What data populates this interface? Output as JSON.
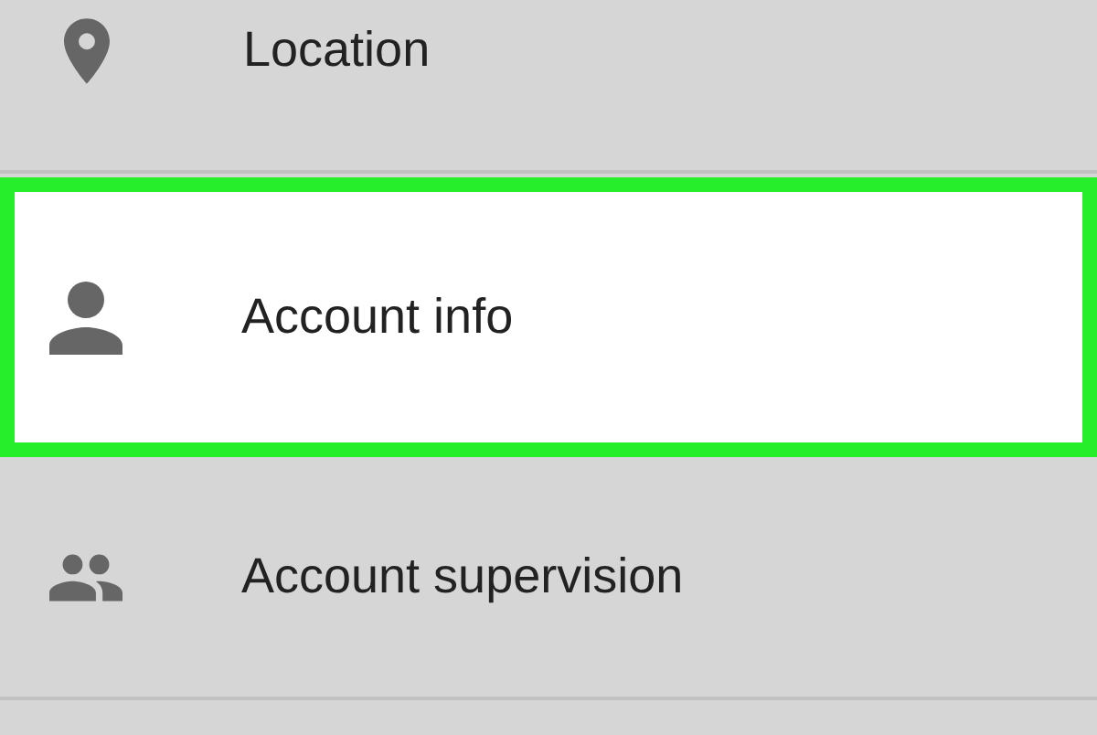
{
  "settings_items": [
    {
      "label": "Location",
      "kind": "location",
      "selected": false
    },
    {
      "label": "Account info",
      "kind": "person",
      "selected": true
    },
    {
      "label": "Account supervision",
      "kind": "group",
      "selected": false
    }
  ]
}
